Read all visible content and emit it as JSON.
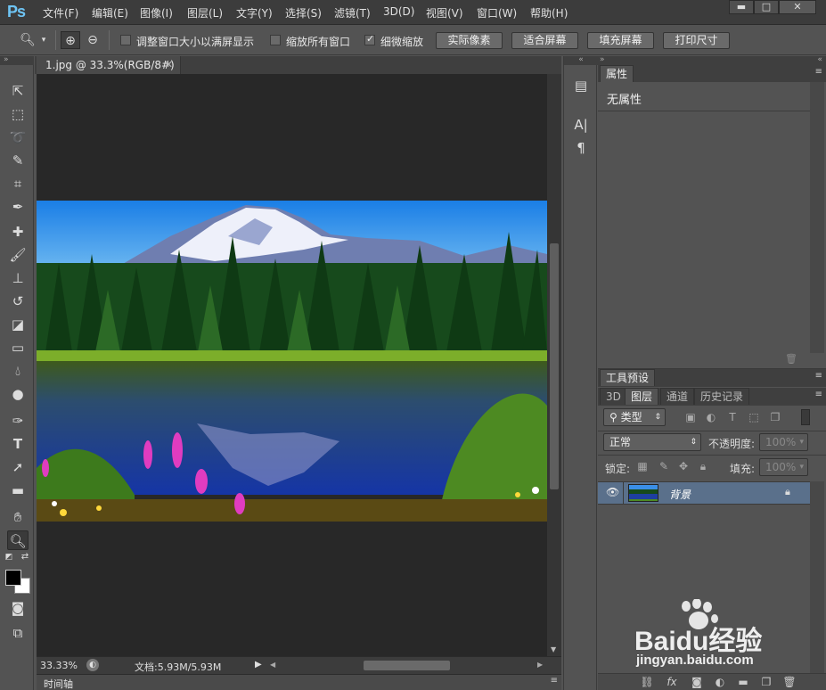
{
  "app": {
    "logo": "Ps"
  },
  "menu": [
    "文件(F)",
    "编辑(E)",
    "图像(I)",
    "图层(L)",
    "文字(Y)",
    "选择(S)",
    "滤镜(T)",
    "3D(D)",
    "视图(V)",
    "窗口(W)",
    "帮助(H)"
  ],
  "window_controls": {
    "minimize": "▬",
    "maximize": "□",
    "close": "✕"
  },
  "options": {
    "resize_windows": {
      "label": "调整窗口大小以满屏显示",
      "checked": false
    },
    "zoom_all_windows": {
      "label": "缩放所有窗口",
      "checked": false
    },
    "scrubby_zoom": {
      "label": "细微缩放",
      "checked": true
    },
    "buttons": [
      "实际像素",
      "适合屏幕",
      "填充屏幕",
      "打印尺寸"
    ]
  },
  "document": {
    "tab_title": "1.jpg @ 33.3%(RGB/8#)",
    "zoom": "33.33%",
    "doc_info": "文档:5.93M/5.93M"
  },
  "timeline": {
    "label": "时间轴"
  },
  "properties": {
    "tab": "属性",
    "empty_text": "无属性"
  },
  "tool_presets": {
    "tab": "工具预设"
  },
  "layers": {
    "tabs": [
      "3D",
      "图层",
      "通道",
      "历史记录"
    ],
    "filter_kind": "类型",
    "blend_mode": "正常",
    "opacity_label": "不透明度:",
    "opacity_value": "100%",
    "lock_label": "锁定:",
    "fill_label": "填充:",
    "fill_value": "100%",
    "layer_name": "背景"
  },
  "watermark": {
    "brand": "Baidu经验",
    "url": "jingyan.baidu.com"
  },
  "colors": {
    "foreground": "#000000",
    "background": "#ffffff",
    "selected_layer": "#5a708b",
    "canvas_bg": "#282828"
  }
}
